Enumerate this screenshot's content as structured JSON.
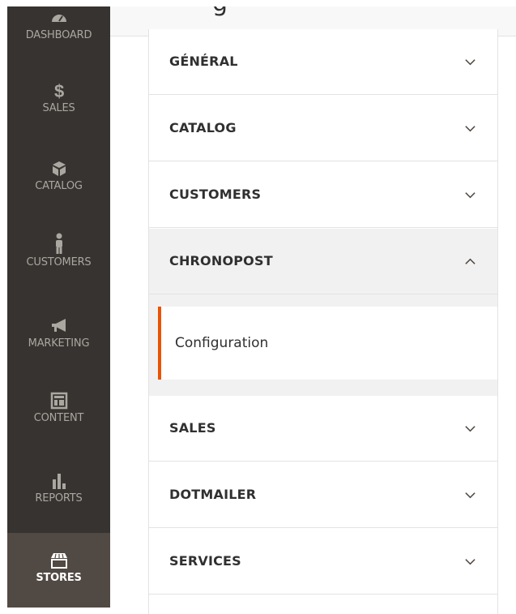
{
  "sidebar": {
    "items": [
      {
        "label": "DASHBOARD",
        "icon": "dashboard-icon"
      },
      {
        "label": "SALES",
        "icon": "dollar-icon"
      },
      {
        "label": "CATALOG",
        "icon": "box-icon"
      },
      {
        "label": "CUSTOMERS",
        "icon": "person-icon"
      },
      {
        "label": "MARKETING",
        "icon": "megaphone-icon"
      },
      {
        "label": "CONTENT",
        "icon": "layout-icon"
      },
      {
        "label": "REPORTS",
        "icon": "bar-chart-icon"
      },
      {
        "label": "STORES",
        "icon": "storefront-icon",
        "active": true
      }
    ]
  },
  "header": {
    "title_fragment": "g"
  },
  "config_tabs": {
    "sections": [
      {
        "label": "GÉNÉRAL",
        "expanded": false
      },
      {
        "label": "CATALOG",
        "expanded": false
      },
      {
        "label": "CUSTOMERS",
        "expanded": false
      },
      {
        "label": "CHRONOPOST",
        "expanded": true
      },
      {
        "label": "SALES",
        "expanded": false
      },
      {
        "label": "DOTMAILER",
        "expanded": false
      },
      {
        "label": "SERVICES",
        "expanded": false
      }
    ],
    "chronopost_items": [
      {
        "label": "Configuration",
        "active": true
      }
    ]
  },
  "colors": {
    "sidebar_bg": "#373330",
    "sidebar_active_bg": "#514943",
    "accent": "#eb5202"
  }
}
